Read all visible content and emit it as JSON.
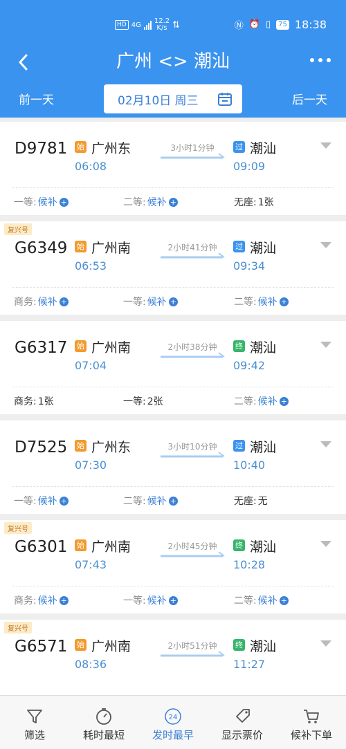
{
  "status_bar": {
    "hd": "HD",
    "net_type": "4G",
    "speed": "12.2",
    "speed_unit": "K/s",
    "battery": "75",
    "time": "18:38"
  },
  "header": {
    "title": "广州 <> 潮汕",
    "prev_day": "前一天",
    "next_day": "后一天",
    "date": "02月10日 周三"
  },
  "trains": [
    {
      "badge": "",
      "number": "D9781",
      "dep_tag": "始",
      "dep_station": "广州东",
      "dep_time": "06:08",
      "duration": "3小时1分钟",
      "arr_tag": "过",
      "arr_station": "潮汕",
      "arr_time": "09:09",
      "seats": [
        {
          "label": "一等:",
          "value": "候补",
          "waitlist": true
        },
        {
          "label": "二等:",
          "value": "候补",
          "waitlist": true
        },
        {
          "label": "无座:",
          "value": "1张",
          "waitlist": false
        }
      ]
    },
    {
      "badge": "复兴号",
      "number": "G6349",
      "dep_tag": "始",
      "dep_station": "广州南",
      "dep_time": "06:53",
      "duration": "2小时41分钟",
      "arr_tag": "过",
      "arr_station": "潮汕",
      "arr_time": "09:34",
      "seats": [
        {
          "label": "商务:",
          "value": "候补",
          "waitlist": true
        },
        {
          "label": "一等:",
          "value": "候补",
          "waitlist": true
        },
        {
          "label": "二等:",
          "value": "候补",
          "waitlist": true
        }
      ]
    },
    {
      "badge": "",
      "number": "G6317",
      "dep_tag": "始",
      "dep_station": "广州南",
      "dep_time": "07:04",
      "duration": "2小时38分钟",
      "arr_tag": "终",
      "arr_station": "潮汕",
      "arr_time": "09:42",
      "seats": [
        {
          "label": "商务:",
          "value": "1张",
          "waitlist": false
        },
        {
          "label": "一等:",
          "value": "2张",
          "waitlist": false
        },
        {
          "label": "二等:",
          "value": "候补",
          "waitlist": true
        }
      ]
    },
    {
      "badge": "",
      "number": "D7525",
      "dep_tag": "始",
      "dep_station": "广州东",
      "dep_time": "07:30",
      "duration": "3小时10分钟",
      "arr_tag": "过",
      "arr_station": "潮汕",
      "arr_time": "10:40",
      "seats": [
        {
          "label": "一等:",
          "value": "候补",
          "waitlist": true
        },
        {
          "label": "二等:",
          "value": "候补",
          "waitlist": true
        },
        {
          "label": "无座:",
          "value": "无",
          "waitlist": false
        }
      ]
    },
    {
      "badge": "复兴号",
      "number": "G6301",
      "dep_tag": "始",
      "dep_station": "广州南",
      "dep_time": "07:43",
      "duration": "2小时45分钟",
      "arr_tag": "终",
      "arr_station": "潮汕",
      "arr_time": "10:28",
      "seats": [
        {
          "label": "商务:",
          "value": "候补",
          "waitlist": true
        },
        {
          "label": "一等:",
          "value": "候补",
          "waitlist": true
        },
        {
          "label": "二等:",
          "value": "候补",
          "waitlist": true
        }
      ]
    },
    {
      "badge": "复兴号",
      "number": "G6571",
      "dep_tag": "始",
      "dep_station": "广州南",
      "dep_time": "08:36",
      "duration": "2小时51分钟",
      "arr_tag": "终",
      "arr_station": "潮汕",
      "arr_time": "11:27",
      "seats": []
    }
  ],
  "bottom_nav": [
    {
      "label": "筛选",
      "icon": "filter-icon"
    },
    {
      "label": "耗时最短",
      "icon": "timer-icon"
    },
    {
      "label": "发时最早",
      "icon": "clock-24-icon",
      "active": true,
      "icon_text": "24"
    },
    {
      "label": "显示票价",
      "icon": "price-tag-icon"
    },
    {
      "label": "候补下单",
      "icon": "cart-icon"
    }
  ],
  "colors": {
    "header_bg": "#3a93ef",
    "accent": "#3a7fd6",
    "start_tag": "#f39a2c",
    "pass_tag": "#3a93ef",
    "end_tag": "#36b56b"
  }
}
